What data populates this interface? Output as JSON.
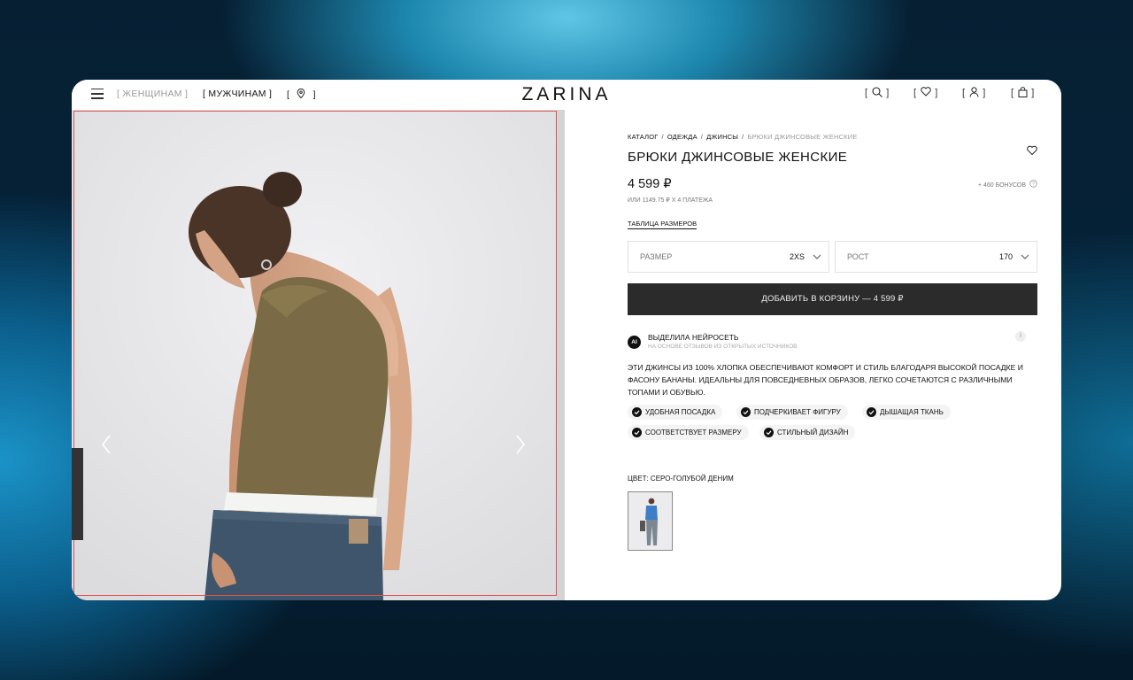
{
  "header": {
    "nav_women": "[ ЖЕНЩИНАМ ]",
    "nav_men": "[ МУЖЧИНАМ ]",
    "nav_location_open": "[",
    "nav_location_close": "]",
    "logo": "ZARINA",
    "icons": [
      "search-icon",
      "heart-icon",
      "user-icon",
      "bag-icon"
    ]
  },
  "breadcrumb": {
    "items": [
      "КАТАЛОГ",
      "ОДЕЖДА",
      "ДЖИНСЫ"
    ],
    "current": "БРЮКИ ДЖИНСОВЫЕ ЖЕНСКИЕ",
    "separator": "/"
  },
  "product": {
    "title": "БРЮКИ ДЖИНСОВЫЕ ЖЕНСКИЕ",
    "price": "4 599 ₽",
    "installments": "ИЛИ 1149.75 ₽ X 4 ПЛАТЕЖА",
    "bonus": "+ 460 БОНУСОВ",
    "size_table_link": "ТАБЛИЦА РАЗМЕРОВ",
    "size_label": "РАЗМЕР",
    "size_value": "2XS",
    "height_label": "РОСТ",
    "height_value": "170",
    "add_to_cart": "ДОБАВИТЬ В КОРЗИНУ — 4 599 ₽"
  },
  "ai_summary": {
    "badge": "AI",
    "title": "ВЫДЕЛИЛА НЕЙРОСЕТЬ",
    "subtitle": "НА ОСНОВЕ ОТЗЫВОВ ИЗ ОТКРЫТЫХ ИСТОЧНИКОВ",
    "info": "i",
    "description": "ЭТИ ДЖИНСЫ ИЗ 100% ХЛОПКА ОБЕСПЕЧИВАЮТ КОМФОРТ И СТИЛЬ БЛАГОДАРЯ ВЫСОКОЙ ПОСАДКЕ И ФАСОНУ БАНАНЫ. ИДЕАЛЬНЫ ДЛЯ ПОВСЕДНЕВНЫХ ОБРАЗОВ, ЛЕГКО СОЧЕТАЮТСЯ С РАЗЛИЧНЫМИ ТОПАМИ И ОБУВЬЮ.",
    "tags": [
      "УДОБНАЯ ПОСАДКА",
      "ПОДЧЕРКИВАЕТ ФИГУРУ",
      "ДЫШАЩАЯ ТКАНЬ",
      "СООТВЕТСТВУЕТ РАЗМЕРУ",
      "СТИЛЬНЫЙ ДИЗАЙН"
    ]
  },
  "color": {
    "label": "ЦВЕТ: СЕРО-ГОЛУБОЙ ДЕНИМ"
  },
  "colors": {
    "button_bg": "#2b2b2b",
    "highlight_border": "#d9534f",
    "gallery_bg": "#e9e9eb",
    "top_olive": "#7a6a45",
    "denim": "#3e556b"
  }
}
